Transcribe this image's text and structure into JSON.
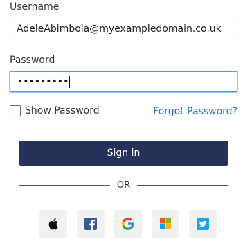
{
  "form": {
    "username_label": "Username",
    "username_value": "AdeleAbimbola@myexampledomain.co.uk",
    "password_label": "Password",
    "password_masked": "•••••••••",
    "show_password_label": "Show Password",
    "show_password_checked": false,
    "forgot_password_label": "Forgot Password?",
    "signin_label": "Sign in",
    "separator_text": "OR"
  },
  "social_login": [
    {
      "name": "apple",
      "icon": "apple-icon"
    },
    {
      "name": "facebook",
      "icon": "facebook-icon",
      "color": "#3b5998"
    },
    {
      "name": "google",
      "icon": "google-icon"
    },
    {
      "name": "microsoft",
      "icon": "microsoft-icon"
    },
    {
      "name": "twitter",
      "icon": "twitter-icon",
      "color": "#1da1f2"
    }
  ],
  "colors": {
    "primary_button": "#27325a",
    "link": "#2f6fb5",
    "focus_border": "#5b9bd5"
  }
}
